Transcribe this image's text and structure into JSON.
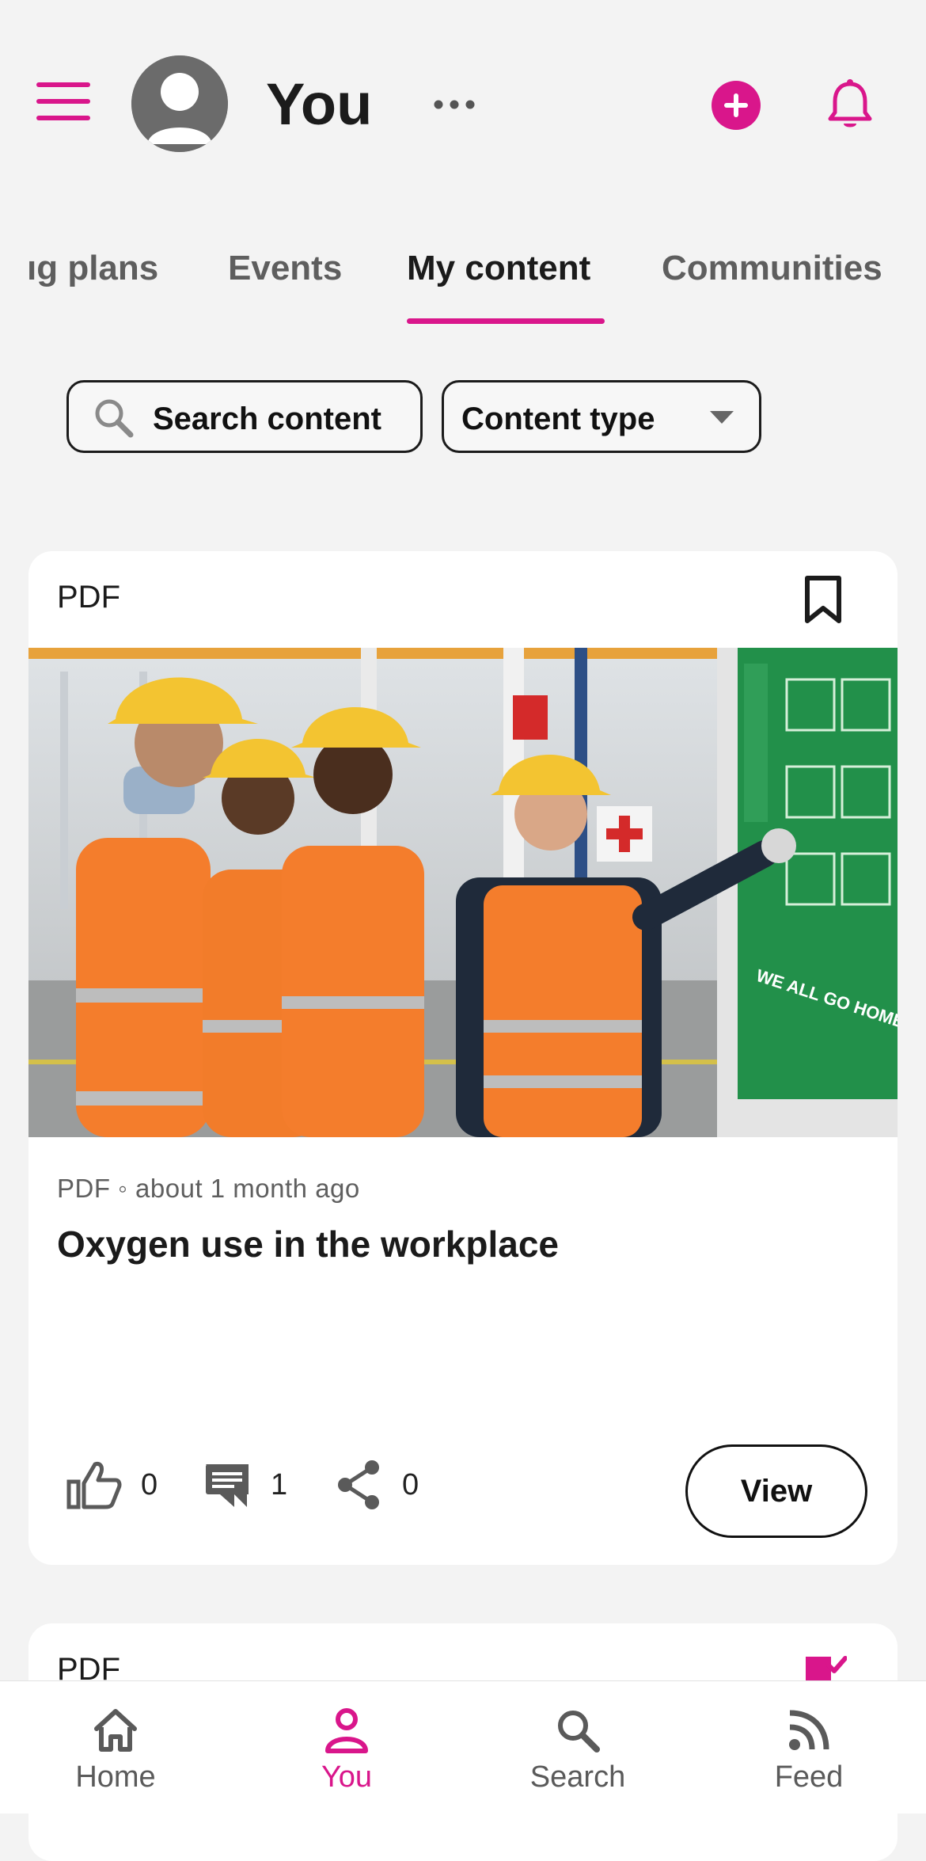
{
  "header": {
    "title": "You",
    "menu_icon": "hamburger-menu-icon",
    "avatar_icon": "user-avatar-icon",
    "more_icon": "ellipsis-icon",
    "add_icon": "plus-circle-icon",
    "notifications_icon": "bell-icon"
  },
  "tabs": [
    {
      "label": "Learning plans",
      "visible_text": "ıg plans"
    },
    {
      "label": "Events"
    },
    {
      "label": "My content",
      "active": true
    },
    {
      "label": "Communities"
    }
  ],
  "filters": {
    "search_label": "Search content",
    "content_type_label": "Content type"
  },
  "cards": [
    {
      "type_label": "PDF",
      "meta": "PDF ◦ about 1 month ago",
      "title": "Oxygen use in the workplace",
      "image_alt": "Workers in hard hats and hi-vis vests looking at a safety sign",
      "poster_text": "WE ALL GO HOME SAFE.",
      "likes": "0",
      "comments": "1",
      "shares": "0",
      "view_label": "View"
    },
    {
      "type_label": "PDF"
    }
  ],
  "bottom_nav": [
    {
      "label": "Home",
      "icon": "home-icon"
    },
    {
      "label": "You",
      "icon": "person-icon",
      "active": true
    },
    {
      "label": "Search",
      "icon": "search-icon"
    },
    {
      "label": "Feed",
      "icon": "rss-feed-icon"
    }
  ],
  "colors": {
    "accent": "#d9168b",
    "background": "#f3f3f3",
    "card": "#ffffff",
    "text": "#1b1b1b",
    "muted": "#5f5f5f"
  }
}
